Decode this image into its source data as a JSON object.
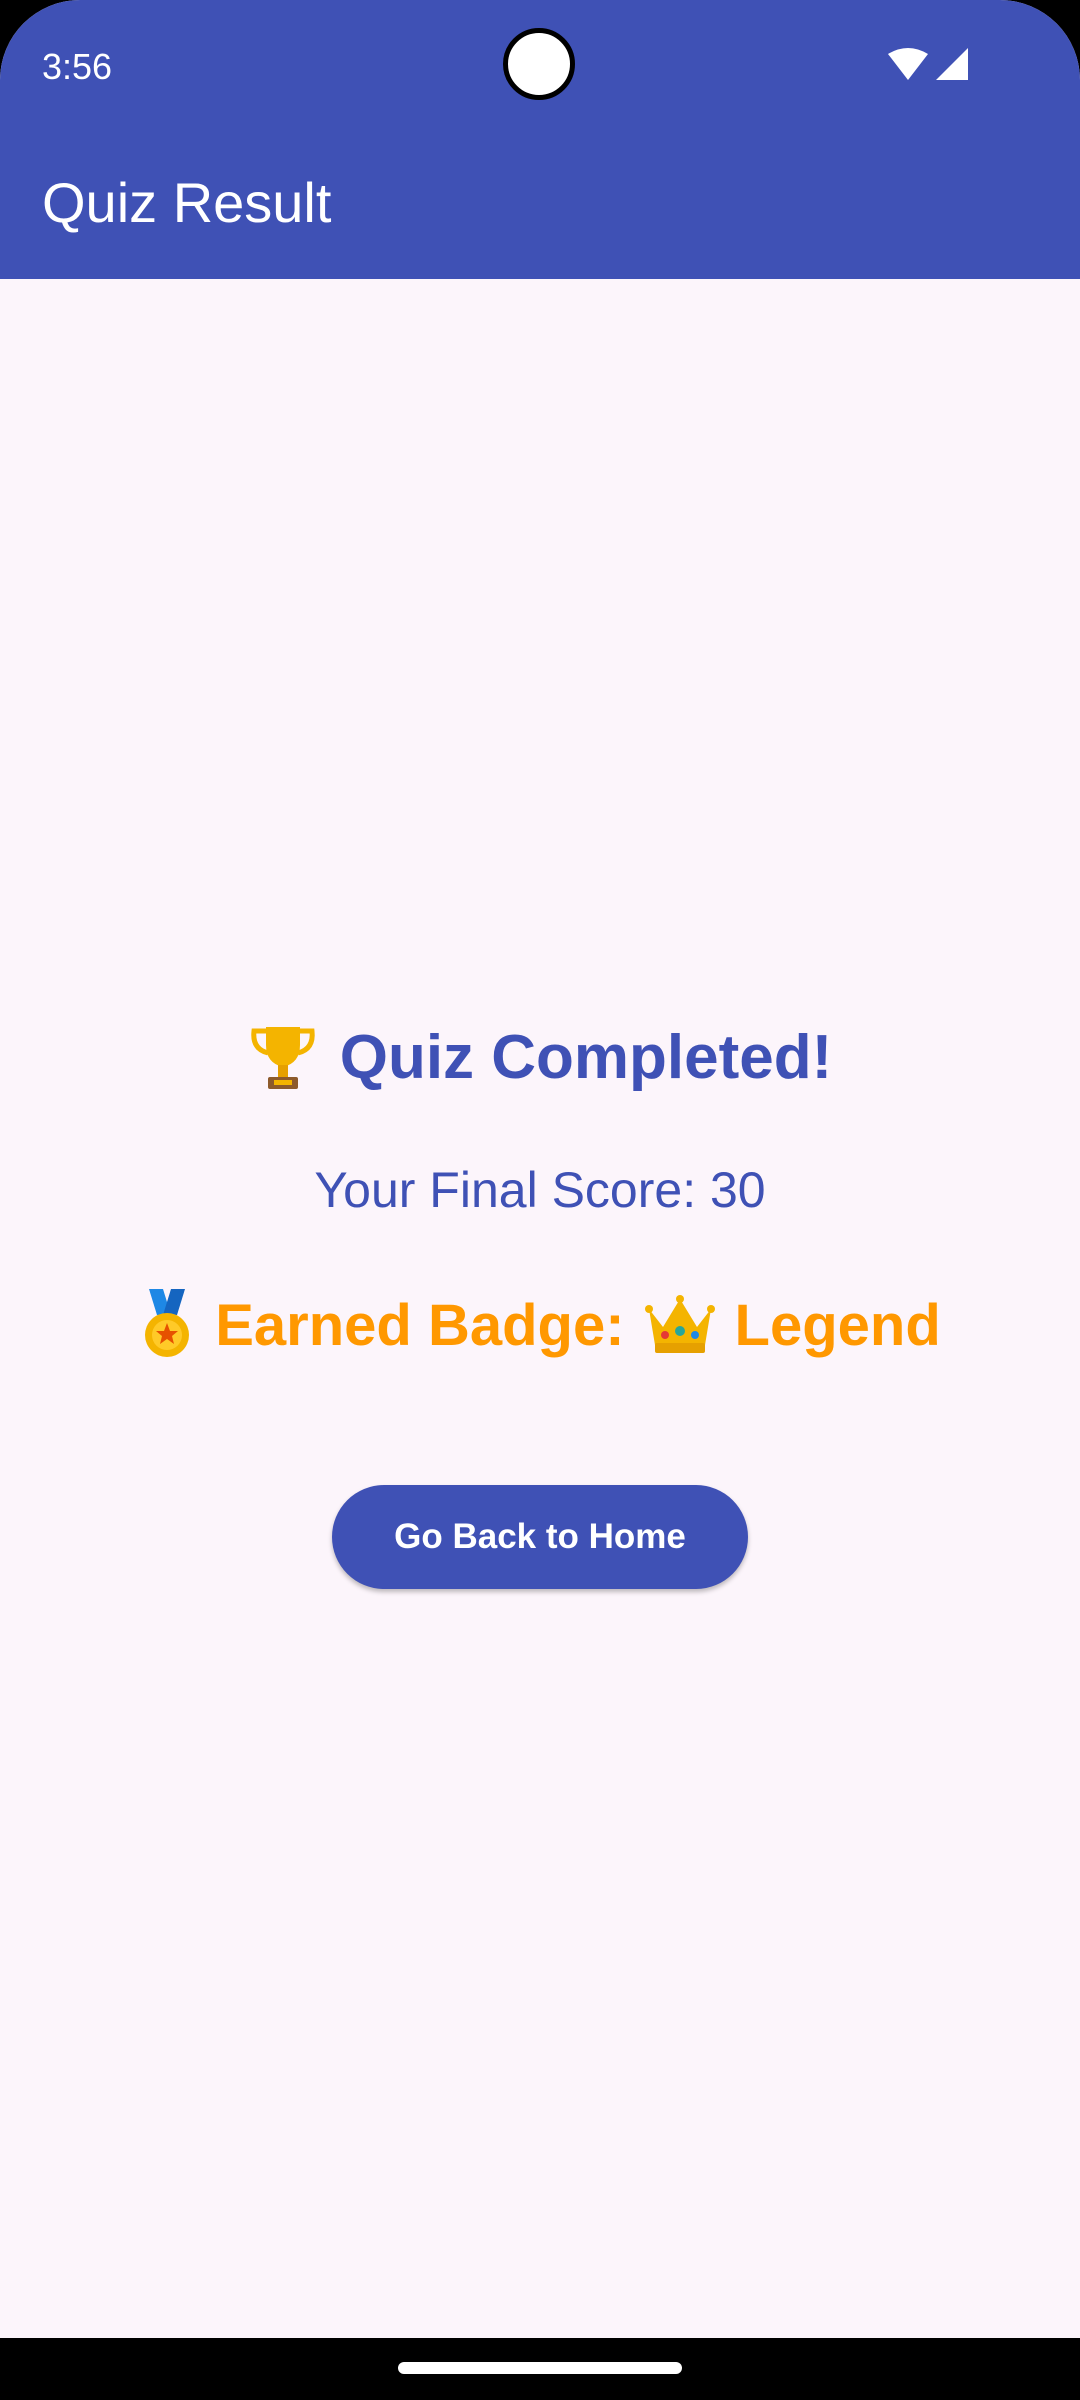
{
  "status_bar": {
    "time": "3:56",
    "icons": [
      "wifi-icon",
      "cellular-signal-icon"
    ],
    "color": "#3F51B5"
  },
  "app_bar": {
    "title": "Quiz Result",
    "color": "#3F51B5"
  },
  "result": {
    "headline_icon": "trophy-icon",
    "headline": "Quiz Completed!",
    "score_text": "Your Final Score: 30",
    "badge_icon": "medal-icon",
    "badge_label": "Earned Badge:",
    "badge_value_icon": "crown-icon",
    "badge_value": "Legend",
    "primary_color": "#3F51B5",
    "badge_color": "#FF9800"
  },
  "actions": {
    "home_button_label": "Go Back to Home"
  }
}
